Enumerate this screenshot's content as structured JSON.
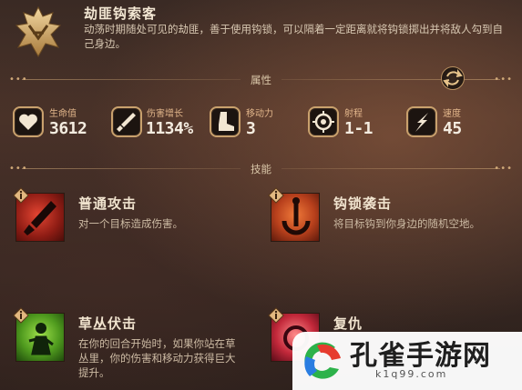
{
  "header": {
    "title": "劫匪钩索客",
    "description": "动荡时期随处可见的劫匪，善于使用钩锁，可以隔着一定距离就将钩锁掷出并将敌人勾到自己身边。"
  },
  "sections": {
    "attributes_label": "属性",
    "skills_label": "技能"
  },
  "stats": [
    {
      "label": "生命值",
      "value": "3612",
      "icon": "heart-icon"
    },
    {
      "label": "伤害增长",
      "value": "1134%",
      "icon": "sword-icon"
    },
    {
      "label": "移动力",
      "value": "3",
      "icon": "boot-icon"
    },
    {
      "label": "射程",
      "value": "1-1",
      "icon": "target-icon"
    },
    {
      "label": "速度",
      "value": "45",
      "icon": "speed-icon"
    }
  ],
  "skills": [
    {
      "name": "普通攻击",
      "description": "对一个目标造成伤害。",
      "icon": "dagger-attack-icon",
      "badge": "info-icon"
    },
    {
      "name": "钩锁袭击",
      "description": "将目标钩到你身边的随机空地。",
      "icon": "anchor-hook-icon",
      "badge": "info-icon"
    },
    {
      "name": "草丛伏击",
      "description": "在你的回合开始时，如果你站在草丛里，你的伤害和移动力获得巨大提升。",
      "icon": "bush-ambush-icon",
      "badge": "info-icon"
    },
    {
      "name": "复仇",
      "description": "",
      "icon": "revenge-icon",
      "badge": "info-icon"
    }
  ],
  "watermark": {
    "text": "孔雀手游网",
    "url": "k1q99.com"
  },
  "colors": {
    "accent_gold": "#c9a16d",
    "stat_label": "#e1b58a",
    "text_primary": "#f1e4cf"
  }
}
